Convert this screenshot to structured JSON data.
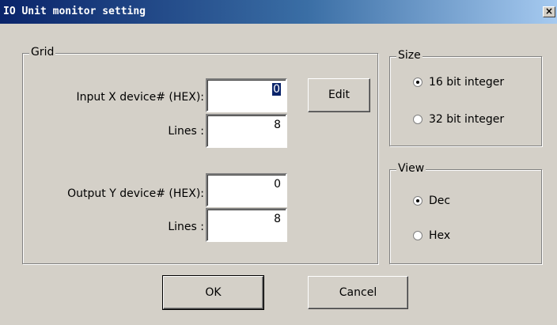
{
  "window": {
    "title": "IO Unit monitor setting",
    "close_glyph": "×"
  },
  "grid": {
    "legend": "Grid",
    "input_label": "Input X device# (HEX):",
    "input_value": "0",
    "input_lines_label": "Lines :",
    "input_lines_value": "8",
    "edit_label": "Edit",
    "output_label": "Output Y device# (HEX):",
    "output_value": "0",
    "output_lines_label": "Lines :",
    "output_lines_value": "8"
  },
  "size": {
    "legend": "Size",
    "options": [
      {
        "label": "16 bit integer",
        "checked": true
      },
      {
        "label": "32 bit integer",
        "checked": false
      }
    ]
  },
  "view": {
    "legend": "View",
    "options": [
      {
        "label": "Dec",
        "checked": true
      },
      {
        "label": "Hex",
        "checked": false
      }
    ]
  },
  "buttons": {
    "ok": "OK",
    "cancel": "Cancel"
  }
}
